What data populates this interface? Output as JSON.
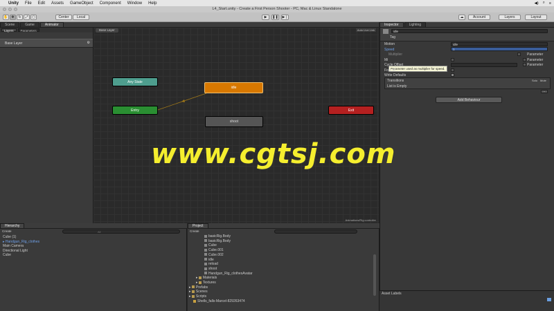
{
  "menubar": {
    "app": "Unity",
    "items": [
      "File",
      "Edit",
      "Assets",
      "GameObject",
      "Component",
      "Window",
      "Help"
    ]
  },
  "window_title": "L4_Start.unity - Create a First Person Shooter - PC, Mac & Linux Standalone",
  "toolbar": {
    "center": "Center",
    "local": "Local",
    "account": "Account",
    "layers": "Layers",
    "layout": "Layout"
  },
  "tabs": {
    "scene": "Scene",
    "game": "Game",
    "animator": "Animator",
    "inspector": "Inspector",
    "lighting": "Lighting",
    "hierarchy": "Hierarchy",
    "project": "Project"
  },
  "animator": {
    "layers_tab": "Layers",
    "parameters_tab": "Parameters",
    "base_layer": "Base Layer",
    "breadcrumb": "Base Layer",
    "auto_live": "Auto Live Link",
    "states": {
      "any": "Any State",
      "entry": "Entry",
      "exit": "Exit",
      "idle": "idle",
      "shoot": "shoot"
    },
    "footer": "Animations/Rig.controller"
  },
  "inspector": {
    "state_name": "idle",
    "tag_label": "Tag",
    "motion_label": "Motion",
    "motion_value": "idle",
    "speed_label": "Speed",
    "speed_value": "1",
    "multiplier_label": "Multiplier",
    "parameter_label": "Parameter",
    "mirror_label": "Mi",
    "cycle_label": "Cycle Offset",
    "foot_ik": "Foot IK",
    "write_defaults": "Write Defaults",
    "transitions": "Transitions",
    "solo": "Solo",
    "mute": "Mute",
    "list_empty": "List is Empty",
    "add_behaviour": "Add Behaviour",
    "tooltip": "Parameter used as multiplier for speed.",
    "asset_labels": "Asset Labels"
  },
  "hierarchy": {
    "create": "Create",
    "search_placeholder": "All",
    "items": [
      "Cube (1)",
      "Handgun_Rig_clothes",
      "Main Camera",
      "Directional Light",
      "Cube"
    ]
  },
  "project": {
    "create": "Create",
    "items": [
      "basicRig.Body",
      "basicRig.Body",
      "Cube",
      "Cube.001",
      "Cube.002",
      "idle",
      "reload",
      "shoot",
      "Handgun_Rig_clothesAvatar"
    ],
    "folders": [
      "Materials",
      "Textures",
      "Prefabs",
      "Scenes",
      "Scripts"
    ],
    "package": "Shells_falls-Marcel-829263474"
  },
  "watermark": "www.cgtsj.com"
}
